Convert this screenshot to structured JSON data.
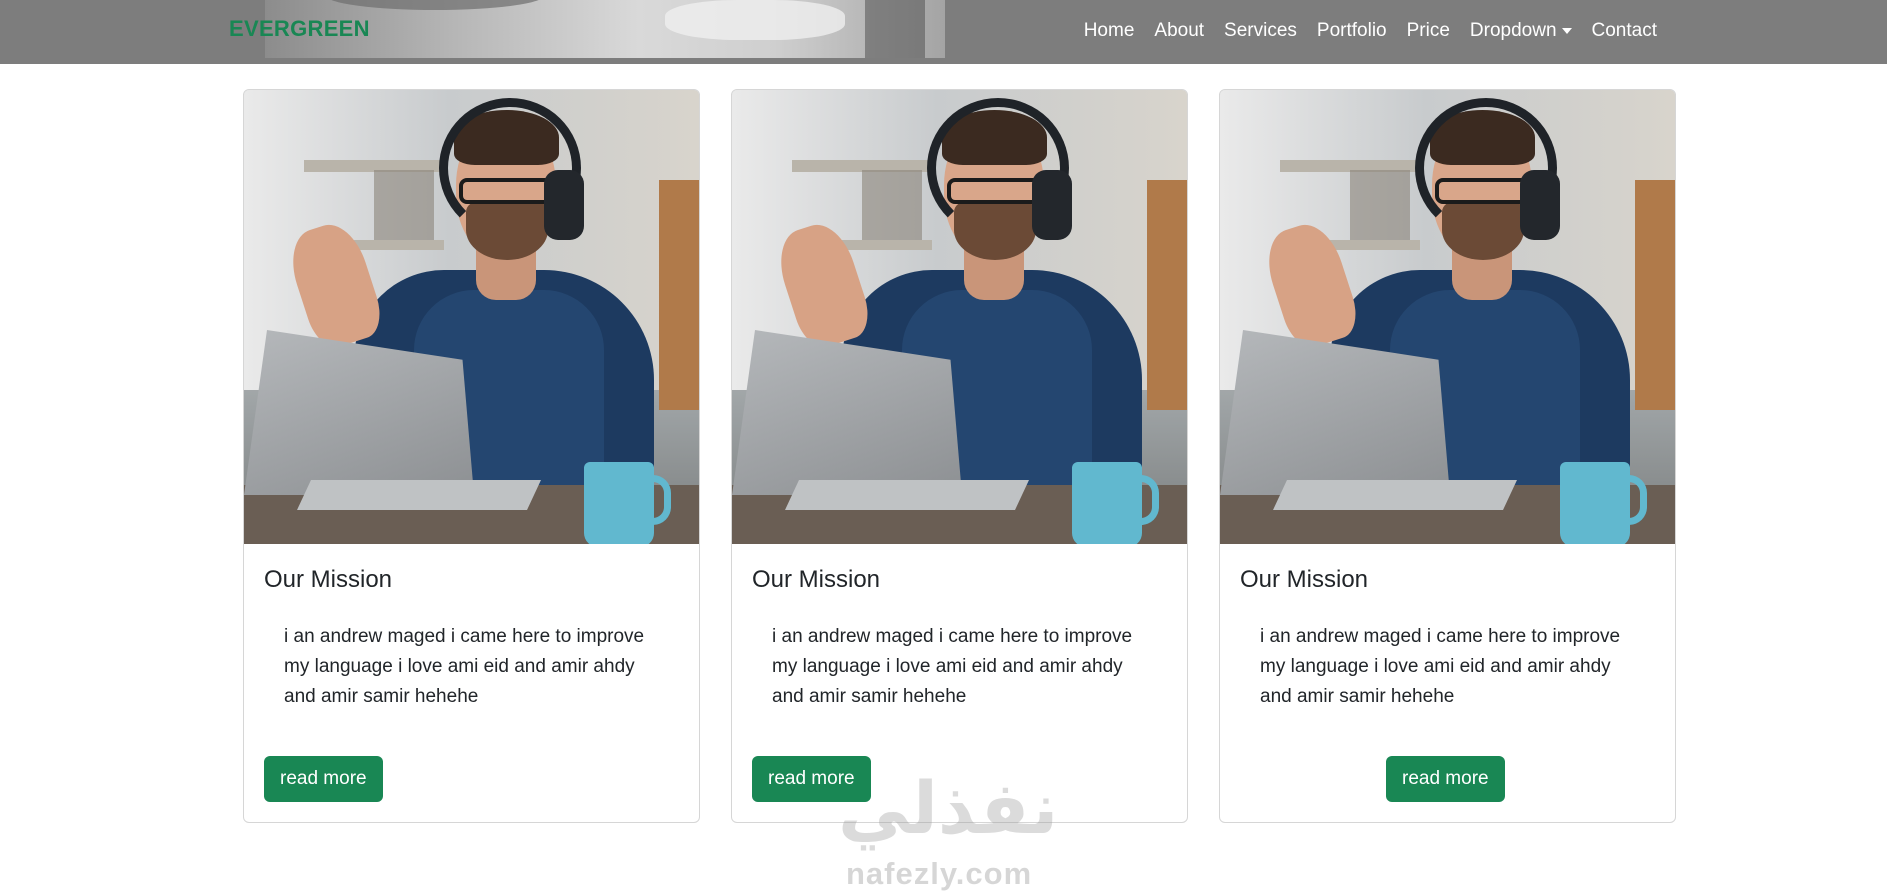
{
  "brand": {
    "name": "EVERGREEN",
    "color": "#198754"
  },
  "nav": {
    "links": [
      {
        "label": "Home"
      },
      {
        "label": "About"
      },
      {
        "label": "Services"
      },
      {
        "label": "Portfolio"
      },
      {
        "label": "Price"
      },
      {
        "label": "Dropdown"
      },
      {
        "label": "Contact"
      }
    ],
    "dropdown_icon": "caret-down-icon"
  },
  "cards": [
    {
      "image": "man-waving-at-laptop-photo",
      "title": "Our Mission",
      "text": "i an andrew maged i came here to improve my language i love ami eid and amir ahdy and amir samir hehehe",
      "button": "read more"
    },
    {
      "image": "man-waving-at-laptop-photo",
      "title": "Our Mission",
      "text": "i an andrew maged i came here to improve my language i love ami eid and amir ahdy and amir samir hehehe",
      "button": "read more"
    },
    {
      "image": "man-waving-at-laptop-photo",
      "title": "Our Mission",
      "text": "i an andrew maged i came here to improve my language i love ami eid and amir ahdy and amir samir hehehe",
      "button": "read more"
    }
  ],
  "watermark": {
    "arabic": "نفذلي",
    "latin": "nafezly.com"
  },
  "colors": {
    "navbar": "#7d7d7d",
    "accent": "#198754",
    "card_border": "#d6d6d6"
  }
}
